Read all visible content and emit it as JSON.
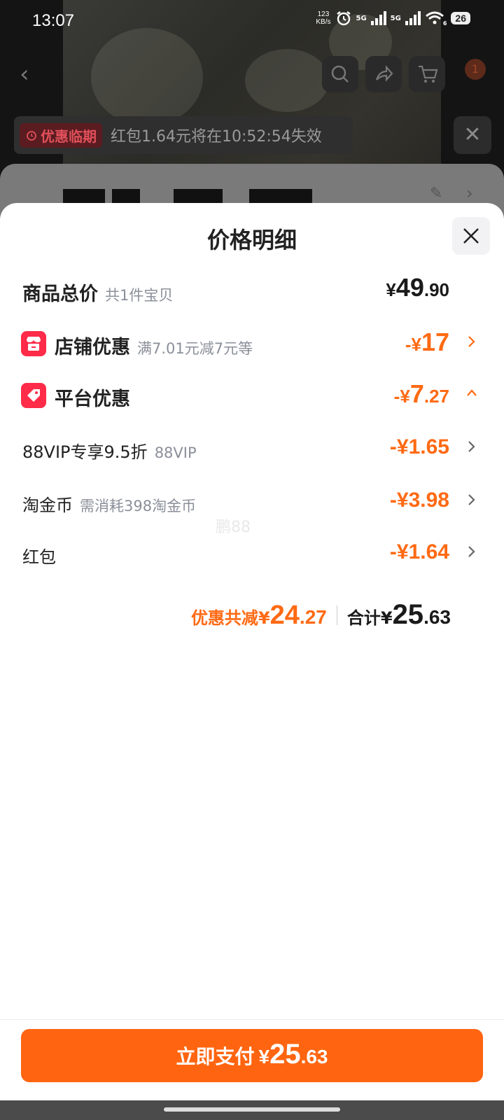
{
  "status_bar": {
    "time": "13:07",
    "net_speed_value": "123",
    "net_speed_unit": "KB/s",
    "sig1_label": "5G",
    "sig2_label": "5G",
    "wifi_sub": "6",
    "battery": "26"
  },
  "background": {
    "cart_badge": "1",
    "promo_tag": "优惠临期",
    "promo_text": "红包1.64元将在10:52:54失效"
  },
  "sheet": {
    "title": "价格明细",
    "total_row": {
      "label": "商品总价",
      "sub": "共1件宝贝",
      "yen": "¥",
      "amount_int": "49",
      "amount_dec": ".90"
    },
    "store_row": {
      "label": "店铺优惠",
      "sub": "满7.01元减7元等",
      "minus": "-",
      "yen": "¥",
      "amount": "17"
    },
    "platform_row": {
      "label": "平台优惠",
      "minus": "-",
      "yen": "¥",
      "amount_int": "7",
      "amount_dec": ".27"
    },
    "vip_row": {
      "label": "88VIP专享9.5折",
      "sub": "88VIP",
      "amount": "-¥1.65"
    },
    "coin_row": {
      "label": "淘金币",
      "sub": "需消耗398淘金币",
      "amount": "-¥3.98"
    },
    "watermark": "鹏88",
    "redpacket_row": {
      "label": "红包",
      "amount": "-¥1.64"
    },
    "summary": {
      "discount_label": "优惠共减",
      "discount_yen": "¥",
      "discount_int": "24",
      "discount_dec": ".27",
      "total_label": "合计",
      "total_yen": "¥",
      "total_int": "25",
      "total_dec": ".63"
    },
    "pay_button": {
      "label": "立即支付",
      "yen": "¥",
      "amount_int": "25",
      "amount_dec": ".63"
    }
  },
  "colors": {
    "accent_orange": "#ff6510",
    "discount_orange": "#ff6a14",
    "icon_red": "#ff2b48",
    "muted_text": "#8a8f99"
  },
  "icons": [
    "alarm-icon",
    "signal-icon",
    "wifi-icon",
    "back-arrow-icon",
    "search-icon",
    "share-icon",
    "cart-icon",
    "close-icon",
    "edit-icon",
    "shop-icon",
    "tag-icon",
    "chevron-right-icon",
    "chevron-up-icon"
  ]
}
